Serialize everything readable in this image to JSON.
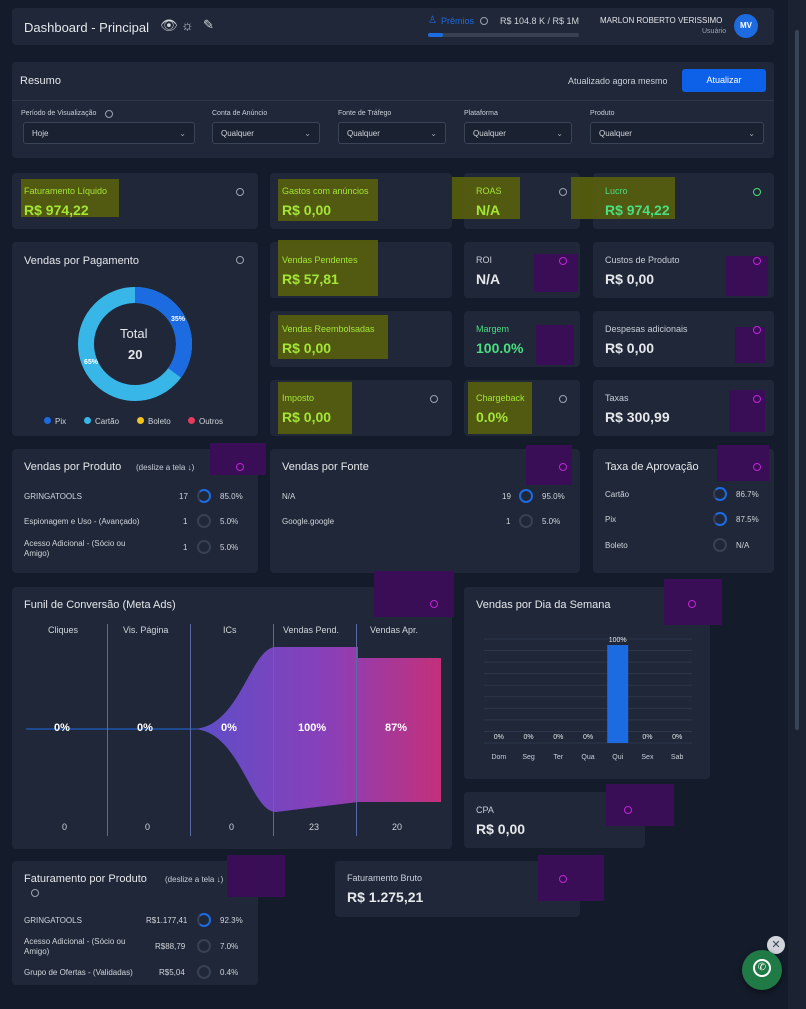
{
  "header": {
    "title": "Dashboard - Principal",
    "prizes_label": "Prêmios",
    "prize_progress": "R$ 104.8 K / R$ 1M",
    "prize_fraction": 0.1,
    "user_name": "MARLON ROBERTO VERISSIMO",
    "user_role": "Usuário",
    "avatar": "MV"
  },
  "resumo": {
    "title": "Resumo",
    "updated": "Atualizado agora mesmo",
    "update_button": "Atualizar",
    "filters": [
      {
        "label": "Período de Visualização",
        "value": "Hoje"
      },
      {
        "label": "Conta de Anúncio",
        "value": "Qualquer"
      },
      {
        "label": "Fonte de Tráfego",
        "value": "Qualquer"
      },
      {
        "label": "Plataforma",
        "value": "Qualquer"
      },
      {
        "label": "Produto",
        "value": "Qualquer"
      }
    ]
  },
  "metrics": {
    "faturamento_liquido": {
      "label": "Faturamento Líquido",
      "value": "R$ 974,22"
    },
    "gastos_anuncios": {
      "label": "Gastos com anúncios",
      "value": "R$ 0,00"
    },
    "roas": {
      "label": "ROAS",
      "value": "N/A"
    },
    "lucro": {
      "label": "Lucro",
      "value": "R$ 974,22"
    },
    "vendas_pendentes": {
      "label": "Vendas Pendentes",
      "value": "R$ 57,81"
    },
    "roi": {
      "label": "ROI",
      "value": "N/A"
    },
    "custos_produto": {
      "label": "Custos de Produto",
      "value": "R$ 0,00"
    },
    "vendas_reembolsadas": {
      "label": "Vendas Reembolsadas",
      "value": "R$ 0,00"
    },
    "margem": {
      "label": "Margem",
      "value": "100.0%"
    },
    "despesas": {
      "label": "Despesas adicionais",
      "value": "R$ 0,00"
    },
    "imposto": {
      "label": "Imposto",
      "value": "R$ 0,00"
    },
    "chargeback": {
      "label": "Chargeback",
      "value": "0.0%"
    },
    "taxas": {
      "label": "Taxas",
      "value": "R$ 300,99"
    }
  },
  "pagamento": {
    "title": "Vendas por Pagamento",
    "total_label": "Total",
    "total": "20",
    "pct_pix": "35%",
    "pct_cartao": "65%",
    "legend": [
      "Pix",
      "Cartão",
      "Boleto",
      "Outros"
    ],
    "colors": [
      "#1d6be0",
      "#38b6e8",
      "#f0c419",
      "#e83a5b"
    ]
  },
  "vendas_produto": {
    "title": "Vendas por Produto",
    "hint": "(deslize a tela ↓)",
    "rows": [
      {
        "name": "GRINGATOOLS",
        "qty": "17",
        "pct": "85.0%"
      },
      {
        "name": "Espionagem e Uso - (Avançado)",
        "qty": "1",
        "pct": "5.0%"
      },
      {
        "name": "Acesso Adicional - (Sócio ou Amigo)",
        "qty": "1",
        "pct": "5.0%"
      }
    ]
  },
  "vendas_fonte": {
    "title": "Vendas por Fonte",
    "rows": [
      {
        "name": "N/A",
        "qty": "19",
        "pct": "95.0%"
      },
      {
        "name": "Google.google",
        "qty": "1",
        "pct": "5.0%"
      }
    ]
  },
  "aprovacao": {
    "title": "Taxa de Aprovação",
    "rows": [
      {
        "name": "Cartão",
        "pct": "86.7%"
      },
      {
        "name": "Pix",
        "pct": "87.5%"
      },
      {
        "name": "Boleto",
        "pct": "N/A"
      }
    ]
  },
  "funil": {
    "title": "Funil de Conversão (Meta Ads)",
    "stages": [
      {
        "name": "Cliques",
        "pct": "0%",
        "count": "0"
      },
      {
        "name": "Vis. Página",
        "pct": "0%",
        "count": "0"
      },
      {
        "name": "ICs",
        "pct": "0%",
        "count": "0"
      },
      {
        "name": "Vendas Pend.",
        "pct": "100%",
        "count": "23"
      },
      {
        "name": "Vendas Apr.",
        "pct": "87%",
        "count": "20"
      }
    ]
  },
  "chart_data": {
    "type": "bar",
    "title": "Vendas por Dia da Semana",
    "categories": [
      "Dom",
      "Seg",
      "Ter",
      "Qua",
      "Qui",
      "Sex",
      "Sab"
    ],
    "values": [
      0,
      0,
      0,
      0,
      100,
      0,
      0
    ],
    "labels": [
      "0%",
      "0%",
      "0%",
      "0%",
      "100%",
      "0%",
      "0%"
    ],
    "ylim": [
      0,
      100
    ],
    "color": "#1d6be0"
  },
  "cpa": {
    "label": "CPA",
    "value": "R$ 0,00"
  },
  "fat_produto": {
    "title": "Faturamento por Produto",
    "hint": "(deslize a tela ↓)",
    "rows": [
      {
        "name": "GRINGATOOLS",
        "value": "R$1.177,41",
        "pct": "92.3%"
      },
      {
        "name": "Acesso Adicional - (Sócio ou Amigo)",
        "value": "R$88,79",
        "pct": "7.0%"
      },
      {
        "name": "Grupo de Ofertas - (Validadas)",
        "value": "R$5,04",
        "pct": "0.4%"
      }
    ]
  },
  "fat_bruto": {
    "label": "Faturamento Bruto",
    "value": "R$ 1.275,21"
  }
}
